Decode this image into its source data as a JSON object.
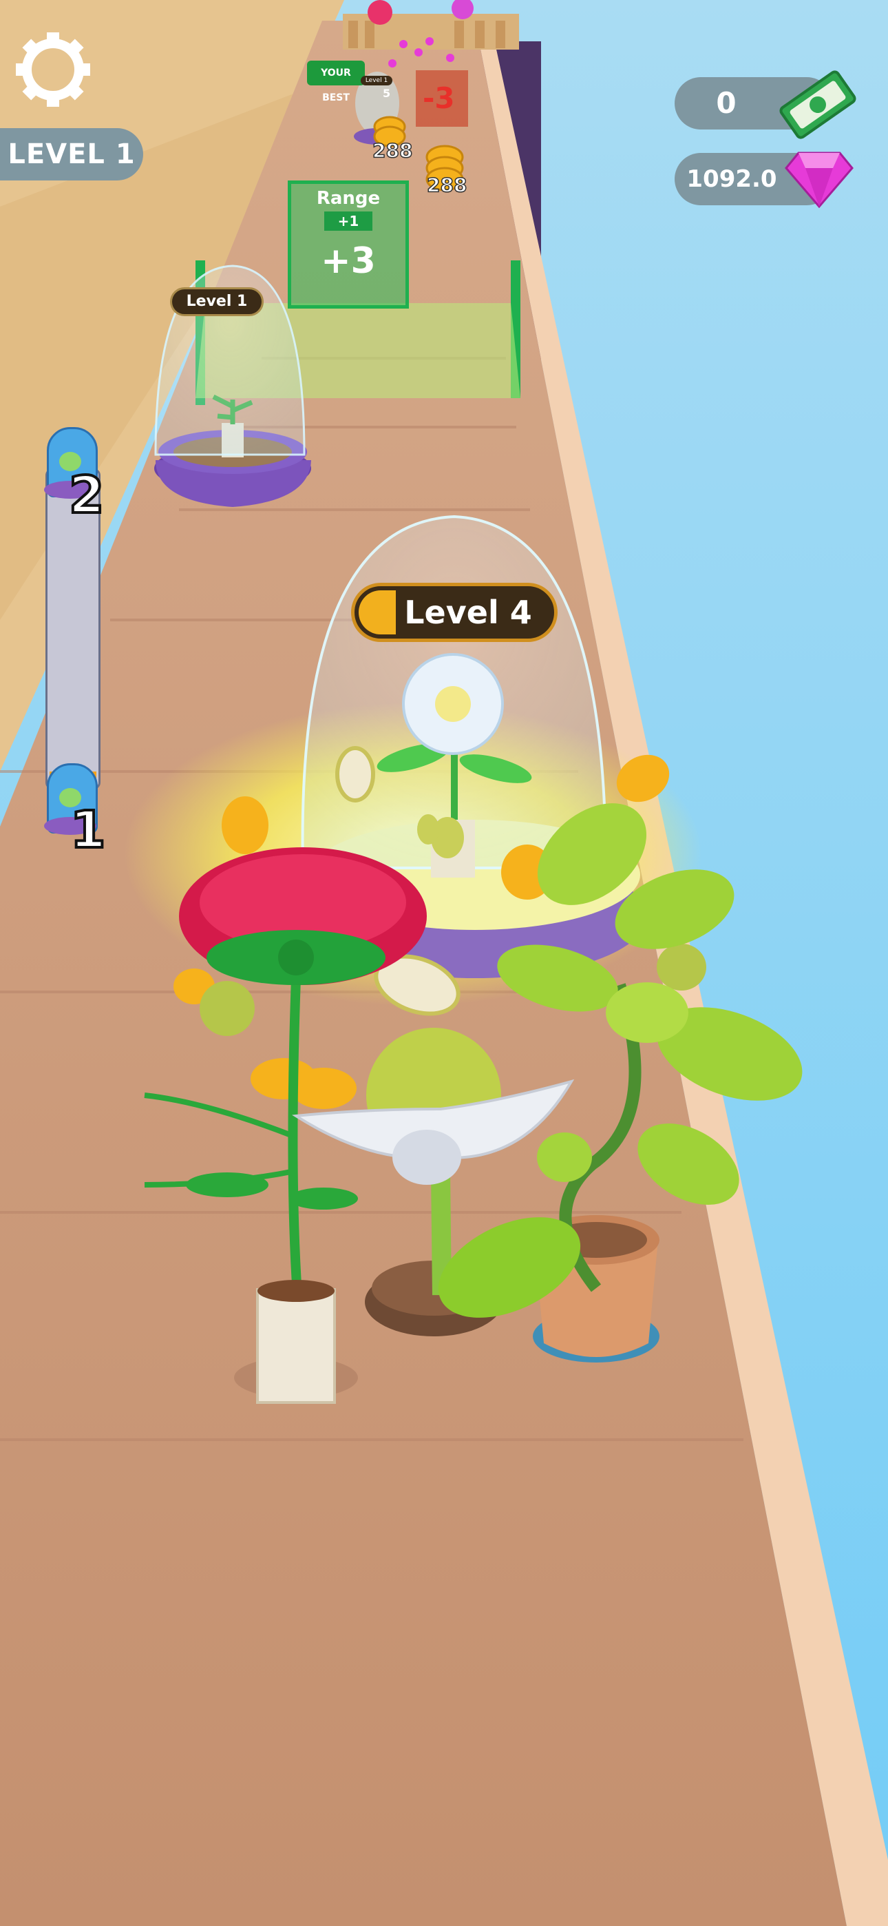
{
  "hud": {
    "level_label": "LEVEL 1",
    "cash_value": "0",
    "gem_value": "1092.0",
    "settings_icon": "gear-icon",
    "cash_icon": "cash-bill-icon",
    "gem_icon": "pink-gem-icon"
  },
  "progress": {
    "top_number": "2",
    "bottom_number": "1",
    "fill_fraction": 0.05
  },
  "track": {
    "gate": {
      "title": "Range",
      "subtitle": "+1",
      "amount": "+3"
    },
    "coin_labels": [
      "288",
      "288"
    ],
    "your_best_label": "YOUR BEST",
    "far_level_label": "Level 1",
    "far_number": "5",
    "minus_gate": "-3"
  },
  "plants": {
    "dome_near_label": "Level 4",
    "dome_far_label": "Level 1"
  },
  "colors": {
    "sky": "#8fd3f4",
    "track": "#c8967a",
    "track_edge": "#f3d1b2",
    "hud_pill": "#7f97a1",
    "gate_green": "#1fb04f",
    "gem_pink": "#e63bd8",
    "label_bg": "#3b2b17",
    "label_accent": "#f2b01e",
    "progress_fill": "#f6a31b"
  }
}
